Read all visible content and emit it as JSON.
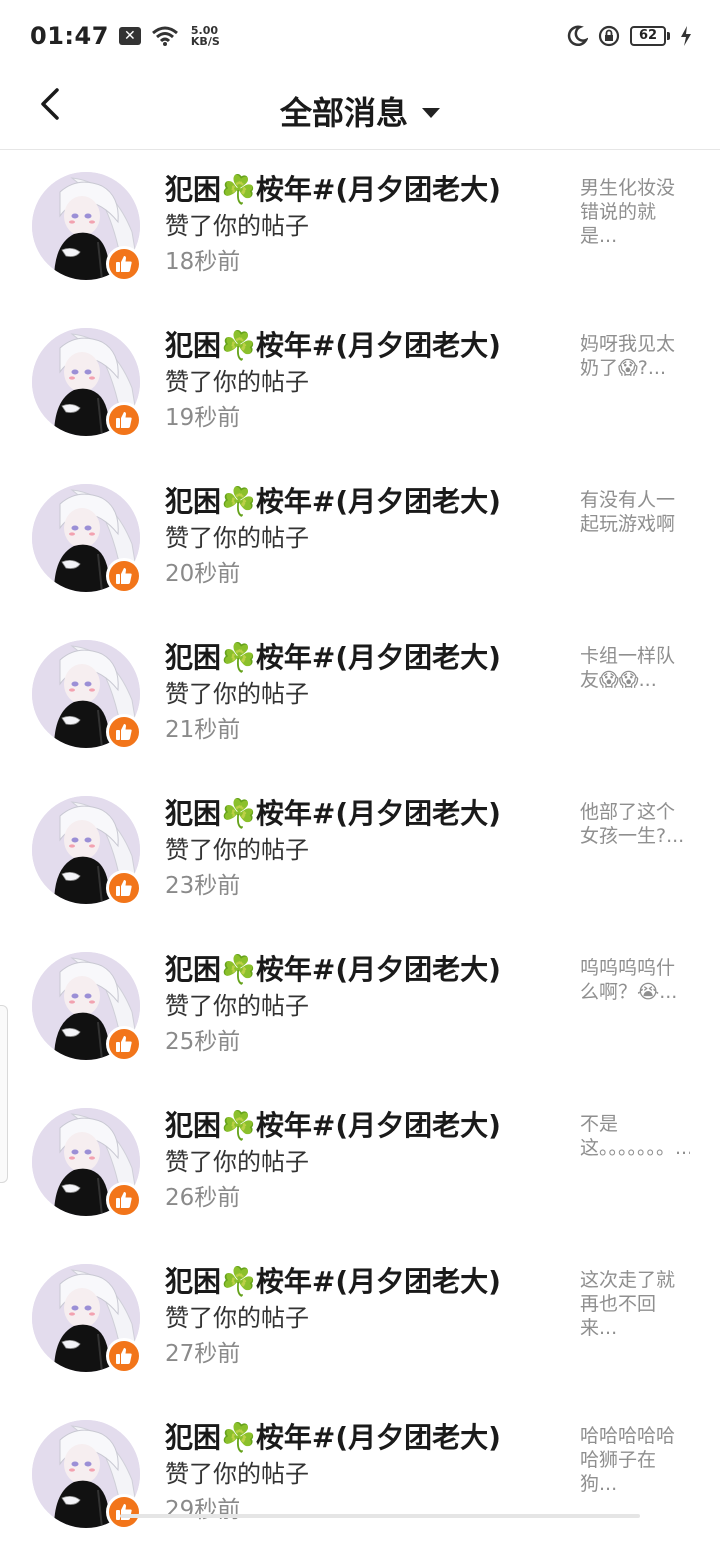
{
  "status_bar": {
    "time": "01:47",
    "notification_icon": "x-icon",
    "wifi_icon": "wifi-icon",
    "net_speed_value": "5.00",
    "net_speed_unit": "KB/S",
    "moon_icon": "moon-icon",
    "lock_icon": "lock-rotation-icon",
    "battery": "62",
    "charging_icon": "bolt-icon"
  },
  "nav": {
    "back_icon": "chevron-left-icon",
    "title": "全部消息",
    "dropdown_icon": "caret-down-icon"
  },
  "messages": [
    {
      "name": "犯困☘️桉年#(月夕团老大)",
      "action": "赞了你的帖子",
      "time": "18秒前",
      "preview": "男生化妆没错说的就是..."
    },
    {
      "name": "犯困☘️桉年#(月夕团老大)",
      "action": "赞了你的帖子",
      "time": "19秒前",
      "preview": "妈呀我见太奶了😱?..."
    },
    {
      "name": "犯困☘️桉年#(月夕团老大)",
      "action": "赞了你的帖子",
      "time": "20秒前",
      "preview": "有没有人一起玩游戏啊"
    },
    {
      "name": "犯困☘️桉年#(月夕团老大)",
      "action": "赞了你的帖子",
      "time": "21秒前",
      "preview": "卡组一样队友😱😱..."
    },
    {
      "name": "犯困☘️桉年#(月夕团老大)",
      "action": "赞了你的帖子",
      "time": "23秒前",
      "preview": "他部了这个女孩一生?..."
    },
    {
      "name": "犯困☘️桉年#(月夕团老大)",
      "action": "赞了你的帖子",
      "time": "25秒前",
      "preview": "呜呜呜呜什么啊？😭..."
    },
    {
      "name": "犯困☘️桉年#(月夕团老大)",
      "action": "赞了你的帖子",
      "time": "26秒前",
      "preview": "不是这。。。。。。。..."
    },
    {
      "name": "犯困☘️桉年#(月夕团老大)",
      "action": "赞了你的帖子",
      "time": "27秒前",
      "preview": "这次走了就再也不回来..."
    },
    {
      "name": "犯困☘️桉年#(月夕团老大)",
      "action": "赞了你的帖子",
      "time": "29秒前",
      "preview": "哈哈哈哈哈哈狮子在狗..."
    }
  ],
  "badge_icon": "thumbs-up-icon",
  "colors": {
    "accent": "#f2751a",
    "avatar_bg": "#e3dced"
  }
}
